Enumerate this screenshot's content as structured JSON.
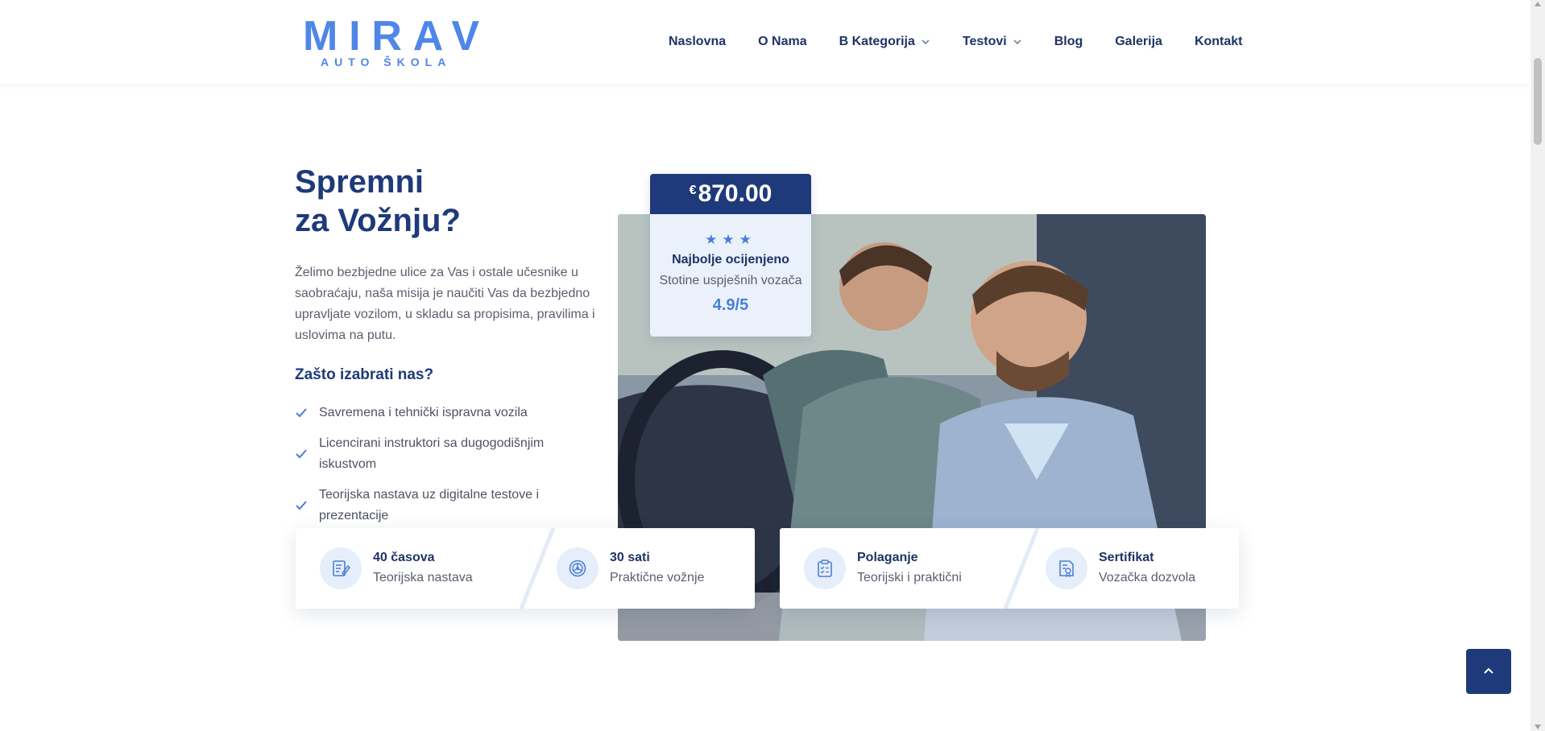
{
  "brand": {
    "logo_text": "MIRAV",
    "logo_sub": "AUTO ŠKOLA"
  },
  "nav": {
    "items": [
      {
        "label": "Naslovna",
        "has_dropdown": false
      },
      {
        "label": "O Nama",
        "has_dropdown": false
      },
      {
        "label": "B Kategorija",
        "has_dropdown": true
      },
      {
        "label": "Testovi",
        "has_dropdown": true
      },
      {
        "label": "Blog",
        "has_dropdown": false
      },
      {
        "label": "Galerija",
        "has_dropdown": false
      },
      {
        "label": "Kontakt",
        "has_dropdown": false
      }
    ]
  },
  "hero": {
    "headline_line1": "Spremni",
    "headline_line2": "za Vožnju?",
    "intro": "Želimo bezbjedne ulice za Vas i ostale učesnike u saobraćaju, naša misija je naučiti Vas da bezbjedno upravljate vozilom, u skladu sa propisima, pravilima i uslovima na putu.",
    "why_title": "Zašto izabrati nas?",
    "features": [
      "Savremena i tehnički ispravna vozila",
      "Licencirani instruktori sa dugogodišnjim iskustvom",
      "Teorijska nastava uz digitalne testove i prezentacije"
    ]
  },
  "price_card": {
    "currency": "€",
    "amount": "870.00",
    "stars": 3,
    "rating_title": "Najbolje ocijenjeno",
    "rating_subtitle": "Stotine uspješnih vozača",
    "rating_score": "4.9/5"
  },
  "stats": [
    {
      "icon": "notebook-pen-icon",
      "title": "40 časova",
      "subtitle": "Teorijska nastava"
    },
    {
      "icon": "steering-wheel-icon",
      "title": "30 sati",
      "subtitle": "Praktične vožnje"
    },
    {
      "icon": "clipboard-check-icon",
      "title": "Polaganje",
      "subtitle": "Teorijski i praktični"
    },
    {
      "icon": "certificate-icon",
      "title": "Sertifikat",
      "subtitle": "Vozačka dozvola"
    }
  ],
  "colors": {
    "primary": "#1f3a7a",
    "accent": "#4a7fd6",
    "logo": "#4f86e8",
    "text_muted": "#5a5f6e"
  }
}
